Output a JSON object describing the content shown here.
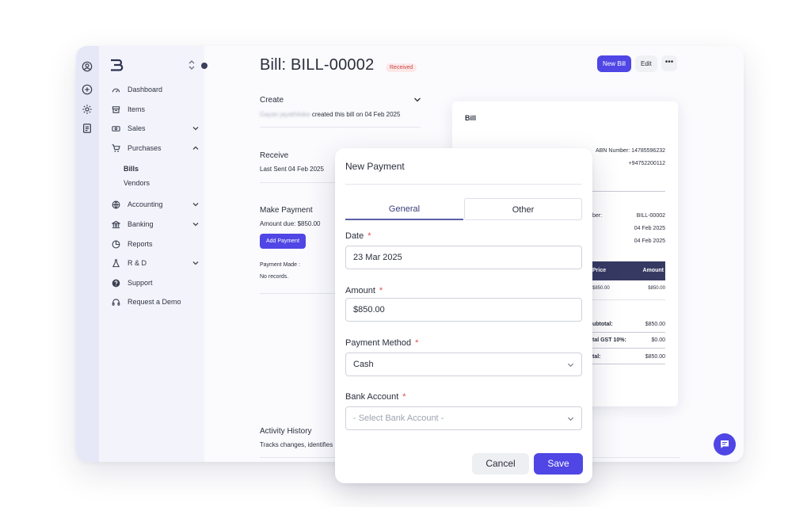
{
  "sidebar": {
    "items": [
      {
        "label": "Dashboard"
      },
      {
        "label": "Items"
      },
      {
        "label": "Sales"
      },
      {
        "label": "Purchases"
      },
      {
        "label": "Bills"
      },
      {
        "label": "Vendors"
      },
      {
        "label": "Accounting"
      },
      {
        "label": "Banking"
      },
      {
        "label": "Reports"
      },
      {
        "label": "R & D"
      },
      {
        "label": "Support"
      },
      {
        "label": "Request a Demo"
      }
    ]
  },
  "header": {
    "title": "Bill: BILL-00002",
    "status": "Received",
    "new_bill": "New Bill",
    "edit": "Edit",
    "more": "•••"
  },
  "create": {
    "title": "Create",
    "user": "Gayan jayathilake",
    "text": "created this bill on 04 Feb 2025"
  },
  "receive": {
    "title": "Receive",
    "text": "Last Sent 04 Feb 2025"
  },
  "payment": {
    "title": "Make Payment",
    "amount_due": "Amount due: $850.00",
    "add": "Add Payment",
    "made_label": "Payment Made :",
    "none": "No records."
  },
  "activity": {
    "title": "Activity History",
    "text": "Tracks changes, identifies"
  },
  "bill_card": {
    "title": "Bill",
    "abn": "ABN Number: 14785596232",
    "phone": "+94752200112",
    "number_label": "ber:",
    "number": "BILL-00002",
    "date1": "04 Feb 2025",
    "date2": "04 Feb 2025",
    "col_price": "Price",
    "col_amount": "Amount",
    "row_price": "$850.00",
    "row_amount": "$850.00",
    "subtotal_label": "ubtotal:",
    "subtotal": "$850.00",
    "gst_label": "tal GST 10%:",
    "gst": "$0.00",
    "total_label": "tal:",
    "total": "$850.00"
  },
  "modal": {
    "title": "New Payment",
    "tabs": [
      "General",
      "Other"
    ],
    "date_label": "Date",
    "date_value": "23 Mar 2025",
    "amount_label": "Amount",
    "amount_value": "$850.00",
    "method_label": "Payment Method",
    "method_value": "Cash",
    "bank_label": "Bank Account",
    "bank_placeholder": "- Select Bank Account -",
    "required": "*",
    "cancel": "Cancel",
    "save": "Save"
  },
  "colors": {
    "accent": "#4f46e5",
    "badge_bg": "#fde8e8",
    "badge_text": "#c64545",
    "table_header": "#363a63"
  }
}
